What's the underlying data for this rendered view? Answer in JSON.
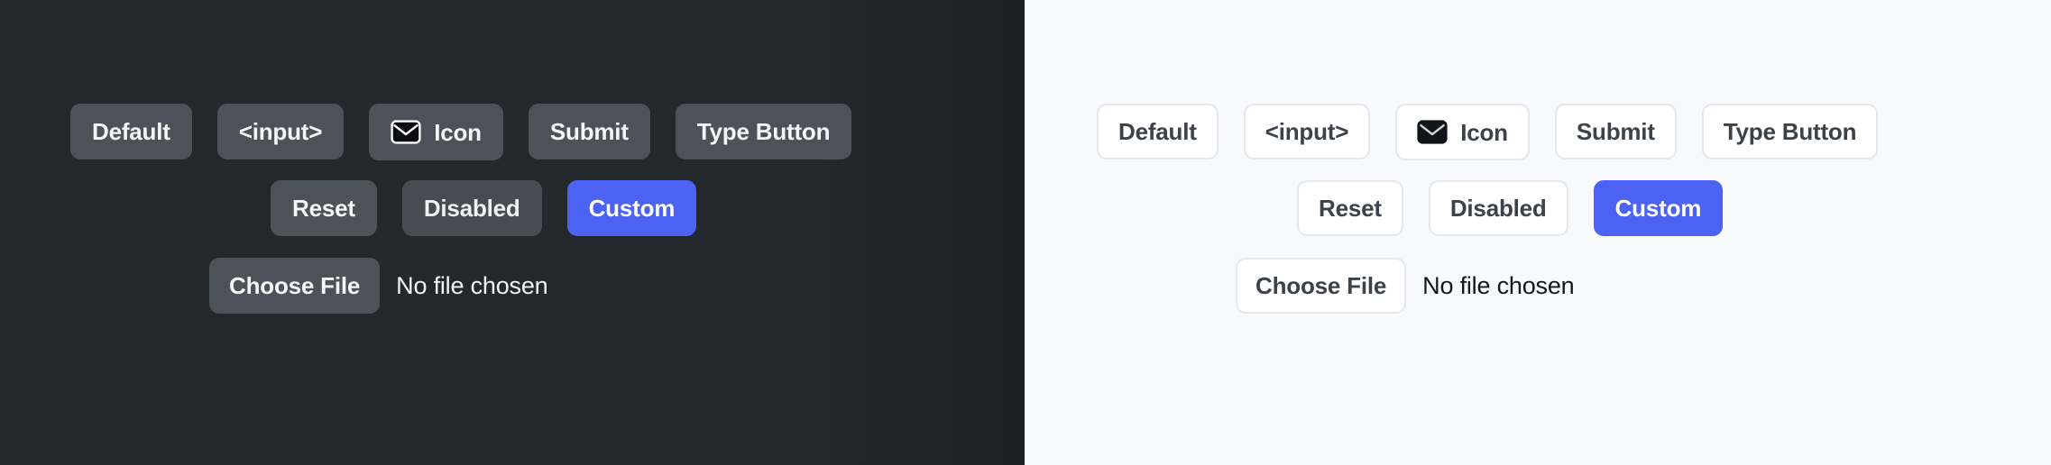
{
  "colors": {
    "dark_background": "#22252a",
    "light_background": "#f8f9fb",
    "dark_button_face": "#4c525a",
    "light_button_face": "#ffffff",
    "light_button_border": "#e4e7ec",
    "dark_button_text": "#f4f5f7",
    "light_button_text": "#3b4249",
    "custom_accent": "#4b62f2",
    "envelope_fill": "#0b0d10"
  },
  "panels": [
    {
      "theme": "dark",
      "rows": [
        [
          {
            "name": "default",
            "label": "Default"
          },
          {
            "name": "input",
            "label": "<input>"
          },
          {
            "name": "icon",
            "label": "Icon",
            "icon": "envelope-icon"
          },
          {
            "name": "submit",
            "label": "Submit"
          },
          {
            "name": "type-button",
            "label": "Type Button"
          }
        ],
        [
          {
            "name": "reset",
            "label": "Reset"
          },
          {
            "name": "disabled",
            "label": "Disabled",
            "state": "disabled"
          },
          {
            "name": "custom",
            "label": "Custom",
            "variant": "custom"
          }
        ],
        [
          {
            "name": "choose-file",
            "label": "Choose File",
            "variant": "file",
            "status": "No file chosen"
          }
        ]
      ]
    },
    {
      "theme": "light",
      "rows": [
        [
          {
            "name": "default",
            "label": "Default"
          },
          {
            "name": "input",
            "label": "<input>"
          },
          {
            "name": "icon",
            "label": "Icon",
            "icon": "envelope-icon"
          },
          {
            "name": "submit",
            "label": "Submit"
          },
          {
            "name": "type-button",
            "label": "Type Button"
          }
        ],
        [
          {
            "name": "reset",
            "label": "Reset"
          },
          {
            "name": "disabled",
            "label": "Disabled",
            "state": "disabled"
          },
          {
            "name": "custom",
            "label": "Custom",
            "variant": "custom"
          }
        ],
        [
          {
            "name": "choose-file",
            "label": "Choose File",
            "variant": "file",
            "status": "No file chosen"
          }
        ]
      ]
    }
  ]
}
